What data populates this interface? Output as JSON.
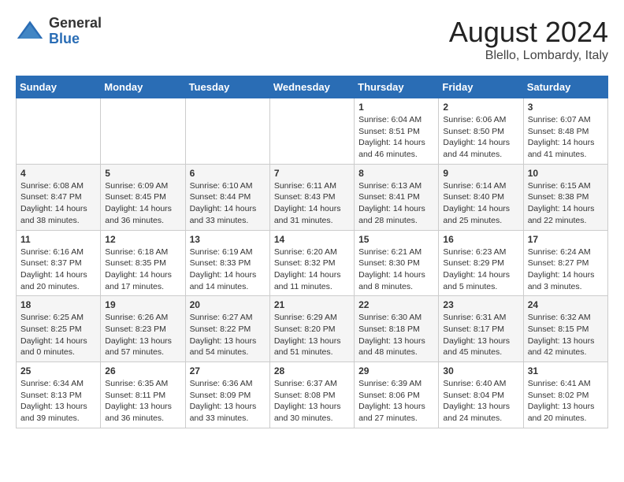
{
  "header": {
    "logo_general": "General",
    "logo_blue": "Blue",
    "month_year": "August 2024",
    "location": "Blello, Lombardy, Italy"
  },
  "weekdays": [
    "Sunday",
    "Monday",
    "Tuesday",
    "Wednesday",
    "Thursday",
    "Friday",
    "Saturday"
  ],
  "weeks": [
    [
      {
        "day": "",
        "info": ""
      },
      {
        "day": "",
        "info": ""
      },
      {
        "day": "",
        "info": ""
      },
      {
        "day": "",
        "info": ""
      },
      {
        "day": "1",
        "info": "Sunrise: 6:04 AM\nSunset: 8:51 PM\nDaylight: 14 hours\nand 46 minutes."
      },
      {
        "day": "2",
        "info": "Sunrise: 6:06 AM\nSunset: 8:50 PM\nDaylight: 14 hours\nand 44 minutes."
      },
      {
        "day": "3",
        "info": "Sunrise: 6:07 AM\nSunset: 8:48 PM\nDaylight: 14 hours\nand 41 minutes."
      }
    ],
    [
      {
        "day": "4",
        "info": "Sunrise: 6:08 AM\nSunset: 8:47 PM\nDaylight: 14 hours\nand 38 minutes."
      },
      {
        "day": "5",
        "info": "Sunrise: 6:09 AM\nSunset: 8:45 PM\nDaylight: 14 hours\nand 36 minutes."
      },
      {
        "day": "6",
        "info": "Sunrise: 6:10 AM\nSunset: 8:44 PM\nDaylight: 14 hours\nand 33 minutes."
      },
      {
        "day": "7",
        "info": "Sunrise: 6:11 AM\nSunset: 8:43 PM\nDaylight: 14 hours\nand 31 minutes."
      },
      {
        "day": "8",
        "info": "Sunrise: 6:13 AM\nSunset: 8:41 PM\nDaylight: 14 hours\nand 28 minutes."
      },
      {
        "day": "9",
        "info": "Sunrise: 6:14 AM\nSunset: 8:40 PM\nDaylight: 14 hours\nand 25 minutes."
      },
      {
        "day": "10",
        "info": "Sunrise: 6:15 AM\nSunset: 8:38 PM\nDaylight: 14 hours\nand 22 minutes."
      }
    ],
    [
      {
        "day": "11",
        "info": "Sunrise: 6:16 AM\nSunset: 8:37 PM\nDaylight: 14 hours\nand 20 minutes."
      },
      {
        "day": "12",
        "info": "Sunrise: 6:18 AM\nSunset: 8:35 PM\nDaylight: 14 hours\nand 17 minutes."
      },
      {
        "day": "13",
        "info": "Sunrise: 6:19 AM\nSunset: 8:33 PM\nDaylight: 14 hours\nand 14 minutes."
      },
      {
        "day": "14",
        "info": "Sunrise: 6:20 AM\nSunset: 8:32 PM\nDaylight: 14 hours\nand 11 minutes."
      },
      {
        "day": "15",
        "info": "Sunrise: 6:21 AM\nSunset: 8:30 PM\nDaylight: 14 hours\nand 8 minutes."
      },
      {
        "day": "16",
        "info": "Sunrise: 6:23 AM\nSunset: 8:29 PM\nDaylight: 14 hours\nand 5 minutes."
      },
      {
        "day": "17",
        "info": "Sunrise: 6:24 AM\nSunset: 8:27 PM\nDaylight: 14 hours\nand 3 minutes."
      }
    ],
    [
      {
        "day": "18",
        "info": "Sunrise: 6:25 AM\nSunset: 8:25 PM\nDaylight: 14 hours\nand 0 minutes."
      },
      {
        "day": "19",
        "info": "Sunrise: 6:26 AM\nSunset: 8:23 PM\nDaylight: 13 hours\nand 57 minutes."
      },
      {
        "day": "20",
        "info": "Sunrise: 6:27 AM\nSunset: 8:22 PM\nDaylight: 13 hours\nand 54 minutes."
      },
      {
        "day": "21",
        "info": "Sunrise: 6:29 AM\nSunset: 8:20 PM\nDaylight: 13 hours\nand 51 minutes."
      },
      {
        "day": "22",
        "info": "Sunrise: 6:30 AM\nSunset: 8:18 PM\nDaylight: 13 hours\nand 48 minutes."
      },
      {
        "day": "23",
        "info": "Sunrise: 6:31 AM\nSunset: 8:17 PM\nDaylight: 13 hours\nand 45 minutes."
      },
      {
        "day": "24",
        "info": "Sunrise: 6:32 AM\nSunset: 8:15 PM\nDaylight: 13 hours\nand 42 minutes."
      }
    ],
    [
      {
        "day": "25",
        "info": "Sunrise: 6:34 AM\nSunset: 8:13 PM\nDaylight: 13 hours\nand 39 minutes."
      },
      {
        "day": "26",
        "info": "Sunrise: 6:35 AM\nSunset: 8:11 PM\nDaylight: 13 hours\nand 36 minutes."
      },
      {
        "day": "27",
        "info": "Sunrise: 6:36 AM\nSunset: 8:09 PM\nDaylight: 13 hours\nand 33 minutes."
      },
      {
        "day": "28",
        "info": "Sunrise: 6:37 AM\nSunset: 8:08 PM\nDaylight: 13 hours\nand 30 minutes."
      },
      {
        "day": "29",
        "info": "Sunrise: 6:39 AM\nSunset: 8:06 PM\nDaylight: 13 hours\nand 27 minutes."
      },
      {
        "day": "30",
        "info": "Sunrise: 6:40 AM\nSunset: 8:04 PM\nDaylight: 13 hours\nand 24 minutes."
      },
      {
        "day": "31",
        "info": "Sunrise: 6:41 AM\nSunset: 8:02 PM\nDaylight: 13 hours\nand 20 minutes."
      }
    ]
  ]
}
